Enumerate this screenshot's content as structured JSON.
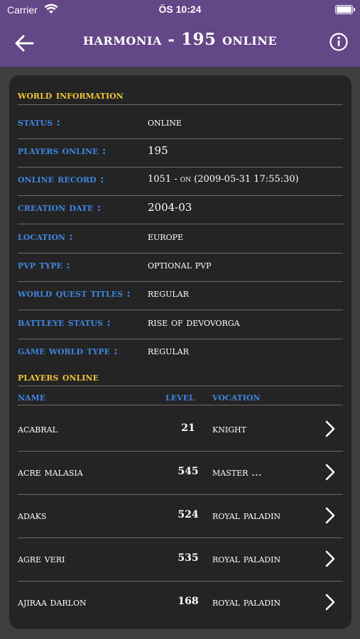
{
  "status_bar": {
    "carrier": "Carrier",
    "time": "ÖS 10:24"
  },
  "nav": {
    "title": "harmonia - 195 online",
    "back_icon": "back-arrow-icon",
    "info_icon": "info-icon"
  },
  "world_info": {
    "title": "world information",
    "rows": [
      {
        "label": "status :",
        "value": "online"
      },
      {
        "label": "players online :",
        "value": "195"
      },
      {
        "label": "online record :",
        "value": "1051 - on (2009-05-31 17:55:30)"
      },
      {
        "label": "creation date :",
        "value": "2004-03"
      },
      {
        "label": "location :",
        "value": "europe"
      },
      {
        "label": "pvp type :",
        "value": "optional pvp"
      },
      {
        "label": "world quest titles :",
        "value": "regular"
      },
      {
        "label": "battleye status :",
        "value": "rise of devovorga"
      },
      {
        "label": "game world type :",
        "value": "regular"
      }
    ]
  },
  "players": {
    "title": "players online",
    "columns": {
      "name": "name",
      "level": "level",
      "vocation": "vocation"
    },
    "rows": [
      {
        "name": "acabral",
        "level": "21",
        "vocation": "knight"
      },
      {
        "name": "acre malasia",
        "level": "545",
        "vocation": "master ..."
      },
      {
        "name": "adaks",
        "level": "524",
        "vocation": "royal paladin"
      },
      {
        "name": "agre veri",
        "level": "535",
        "vocation": "royal paladin"
      },
      {
        "name": "ajiraa darlon",
        "level": "168",
        "vocation": "royal paladin"
      }
    ]
  },
  "colors": {
    "nav": "#634787",
    "background": "#3f3f3f",
    "card": "#242424",
    "label": "#3e86e0",
    "section": "#f2c438"
  }
}
